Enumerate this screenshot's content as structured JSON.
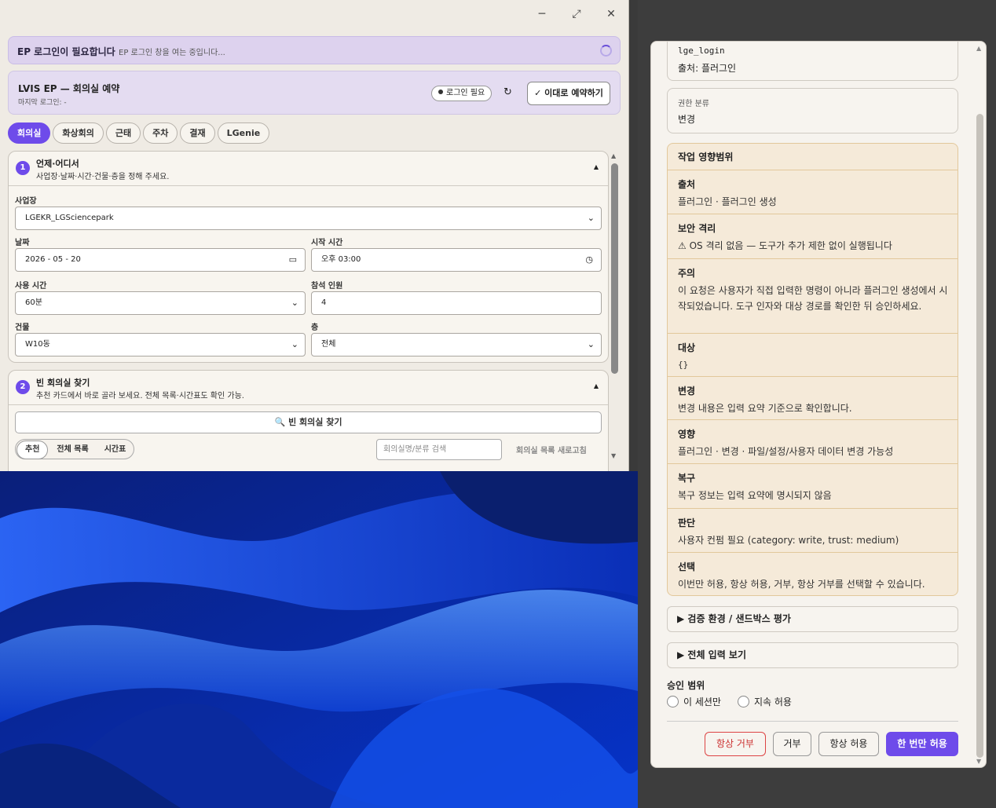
{
  "left_window": {
    "window_controls": {
      "minimize": "─",
      "maximize": "⤢",
      "close": "✕"
    },
    "login_banner": {
      "title": "EP 로그인이 필요합니다",
      "status": "EP 로그인 창을 여는 중입니다..."
    },
    "header_card": {
      "title": "LVIS EP — 회의실 예약",
      "last_login": "마지막 로그인: -",
      "login_badge": "로그인 필요",
      "refresh_icon": "↻",
      "reserve_button": "✓ 이대로 예약하기"
    },
    "tabs": [
      "회의실",
      "화상회의",
      "근태",
      "주차",
      "결재",
      "LGenie"
    ],
    "active_tab": "회의실",
    "section1": {
      "number": "1",
      "title": "언제·어디서",
      "subtitle": "사업장·날짜·시간·건물·층을 정해 주세요.",
      "site_label": "사업장",
      "site_value": "LGEKR_LGSciencepark",
      "date_label": "날짜",
      "date_value": "2026 - 05 - 20",
      "start_label": "시작 시간",
      "start_value": "오후 03:00",
      "duration_label": "사용 시간",
      "duration_value": "60분",
      "attendees_label": "참석 인원",
      "attendees_value": "4",
      "building_label": "건물",
      "building_value": "W10동",
      "floor_label": "층",
      "floor_value": "전체"
    },
    "section2": {
      "number": "2",
      "title": "빈 회의실 찾기",
      "subtitle": "추천 카드에서 바로 골라 보세요. 전체 목록·시간표도 확인 가능.",
      "find_button": "🔍 빈 회의실 찾기",
      "view_modes": [
        "추천",
        "전체 목록",
        "시간표"
      ],
      "active_view": "추천",
      "search_placeholder": "회의실명/분류 검색",
      "reload_link": "회의실 목록 새로고침"
    }
  },
  "right_panel": {
    "top_box": {
      "line1": "lge_login",
      "line2": "출처: 플러그인"
    },
    "permission_box": {
      "label": "권한 분류",
      "value": "변경"
    },
    "impact": {
      "title": "작업 영향범위",
      "rows": [
        {
          "key": "출처",
          "value": "플러그인 · 플러그인 생성"
        },
        {
          "key": "보안 격리",
          "value": "⚠ OS 격리 없음 — 도구가 추가 제한 없이 실행됩니다"
        },
        {
          "key": "주의",
          "value": "이 요청은 사용자가 직접 입력한 명령이 아니라 플러그인 생성에서 시작되었습니다. 도구 인자와 대상 경로를 확인한 뒤 승인하세요."
        },
        {
          "key": "대상",
          "value": "{}"
        },
        {
          "key": "변경",
          "value": "변경 내용은 입력 요약 기준으로 확인합니다."
        },
        {
          "key": "영향",
          "value": "플러그인 · 변경 · 파일/설정/사용자 데이터 변경 가능성"
        },
        {
          "key": "복구",
          "value": "복구 정보는 입력 요약에 명시되지 않음"
        },
        {
          "key": "판단",
          "value": "사용자 컨펌 필요 (category: write, trust: medium)"
        },
        {
          "key": "선택",
          "value": "이번만 허용, 항상 허용, 거부, 항상 거부를 선택할 수 있습니다."
        }
      ]
    },
    "details": [
      "▶ 검증 환경 / 샌드박스 평가",
      "▶ 전체 입력 보기"
    ],
    "approval_scope": {
      "label": "승인 범위",
      "options": [
        "이 세션만",
        "지속 허용"
      ]
    },
    "buttons": {
      "always_deny": "항상 거부",
      "deny": "거부",
      "always_allow": "항상 허용",
      "allow_once": "한 번만 허용"
    },
    "colors": {
      "accent": "#6e4bea",
      "deny": "#d44444",
      "impact_bg": "#f5ead9"
    }
  }
}
